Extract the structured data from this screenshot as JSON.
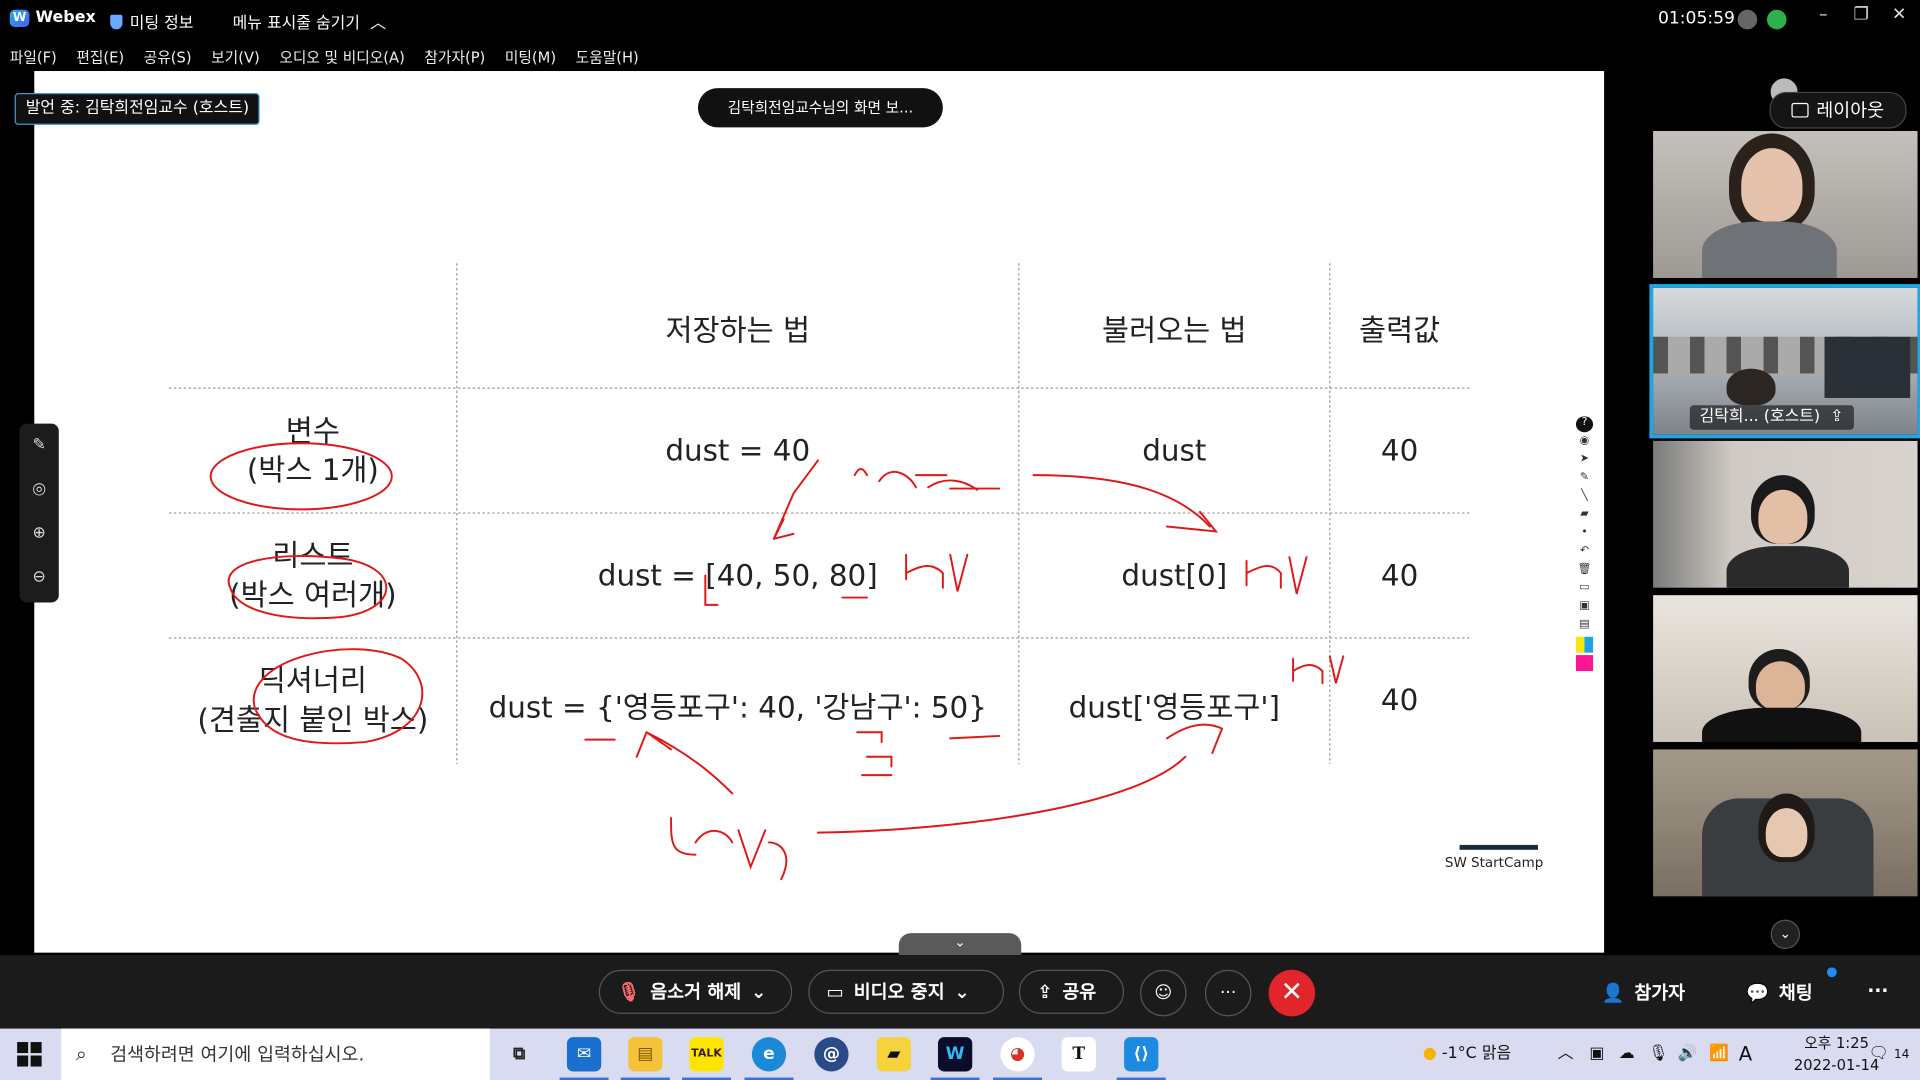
{
  "titlebar": {
    "app_name": "Webex",
    "meeting_info": "미팅 정보",
    "hide_menu": "메뉴 표시줄 숨기기",
    "clock": "01:05:59"
  },
  "menu": [
    "파일(F)",
    "편집(E)",
    "공유(S)",
    "보기(V)",
    "오디오 및 비디오(A)",
    "참가자(P)",
    "미팅(M)",
    "도움말(H)"
  ],
  "stage": {
    "presenter_tag": "발언 중: 김탁희전임교수 (호스트)",
    "view_pill": "김탁희전임교수님의 화면 보...",
    "layout_button": "레이아웃"
  },
  "slide": {
    "headers": [
      "저장하는 법",
      "불러오는 법",
      "출력값"
    ],
    "rows": [
      {
        "label_line1": "변수",
        "label_line2": "(박스 1개)",
        "store": "dust = 40",
        "load": "dust",
        "output": "40"
      },
      {
        "label_line1": "리스트",
        "label_line2": "(박스 여러개)",
        "store": "dust = [40, 50, 80]",
        "load": "dust[0]",
        "output": "40"
      },
      {
        "label_line1": "딕셔너리",
        "label_line2": "(견출지 붙인 박스)",
        "store": "dust = {'영등포구': 40, '강남구': 50}",
        "load": "dust['영등포구']",
        "output": "40"
      }
    ],
    "brand": "SW StartCamp"
  },
  "participants": [
    {
      "name": ""
    },
    {
      "name": "김탁희... (호스트)"
    },
    {
      "name": ""
    },
    {
      "name": ""
    },
    {
      "name": ""
    }
  ],
  "controls": {
    "mute": "음소거 해제",
    "video": "비디오 중지",
    "share": "공유",
    "participants": "참가자",
    "chat": "채팅"
  },
  "taskbar": {
    "search_placeholder": "검색하려면 여기에 입력하십시오.",
    "weather": "-1°C  맑음",
    "time": "오후 1:25",
    "date": "2022-01-14",
    "notifications": "14"
  },
  "colors": {
    "accent": "#1aa7ec",
    "end_call": "#e0262b",
    "ink": "#e01818"
  }
}
